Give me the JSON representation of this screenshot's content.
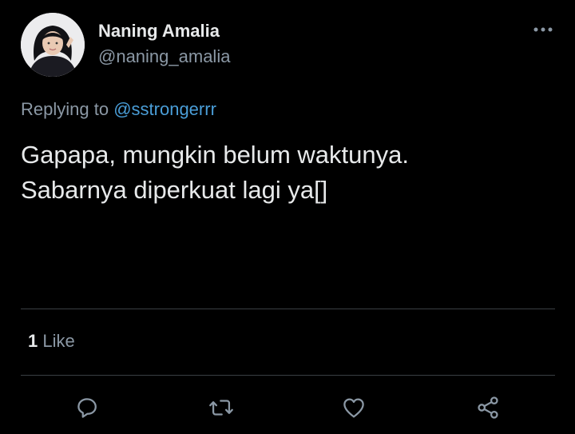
{
  "tweet": {
    "author": {
      "name": "Naning Amalia",
      "handle": "@naning_amalia",
      "avatar_icon": "profile-photo"
    },
    "menu_icon": "more-horizontal-icon",
    "reply_prefix": "Replying to",
    "reply_to": "@sstrongerrr",
    "text_lines": [
      "Gapapa, mungkin belum waktunya.",
      "Sabarnya diperkuat lagi ya[]"
    ],
    "likes": {
      "count": "1",
      "label": "Like"
    },
    "actions": [
      {
        "name": "reply",
        "icon": "comment-icon"
      },
      {
        "name": "retweet",
        "icon": "retweet-icon"
      },
      {
        "name": "like",
        "icon": "heart-icon"
      },
      {
        "name": "share",
        "icon": "share-icon"
      }
    ]
  },
  "colors": {
    "background": "#000000",
    "primary_text": "#e7e9ea",
    "secondary_text": "#8b98a5",
    "link": "#4a9ed8",
    "divider": "#3a3f44",
    "icon": "#8b98a5"
  }
}
